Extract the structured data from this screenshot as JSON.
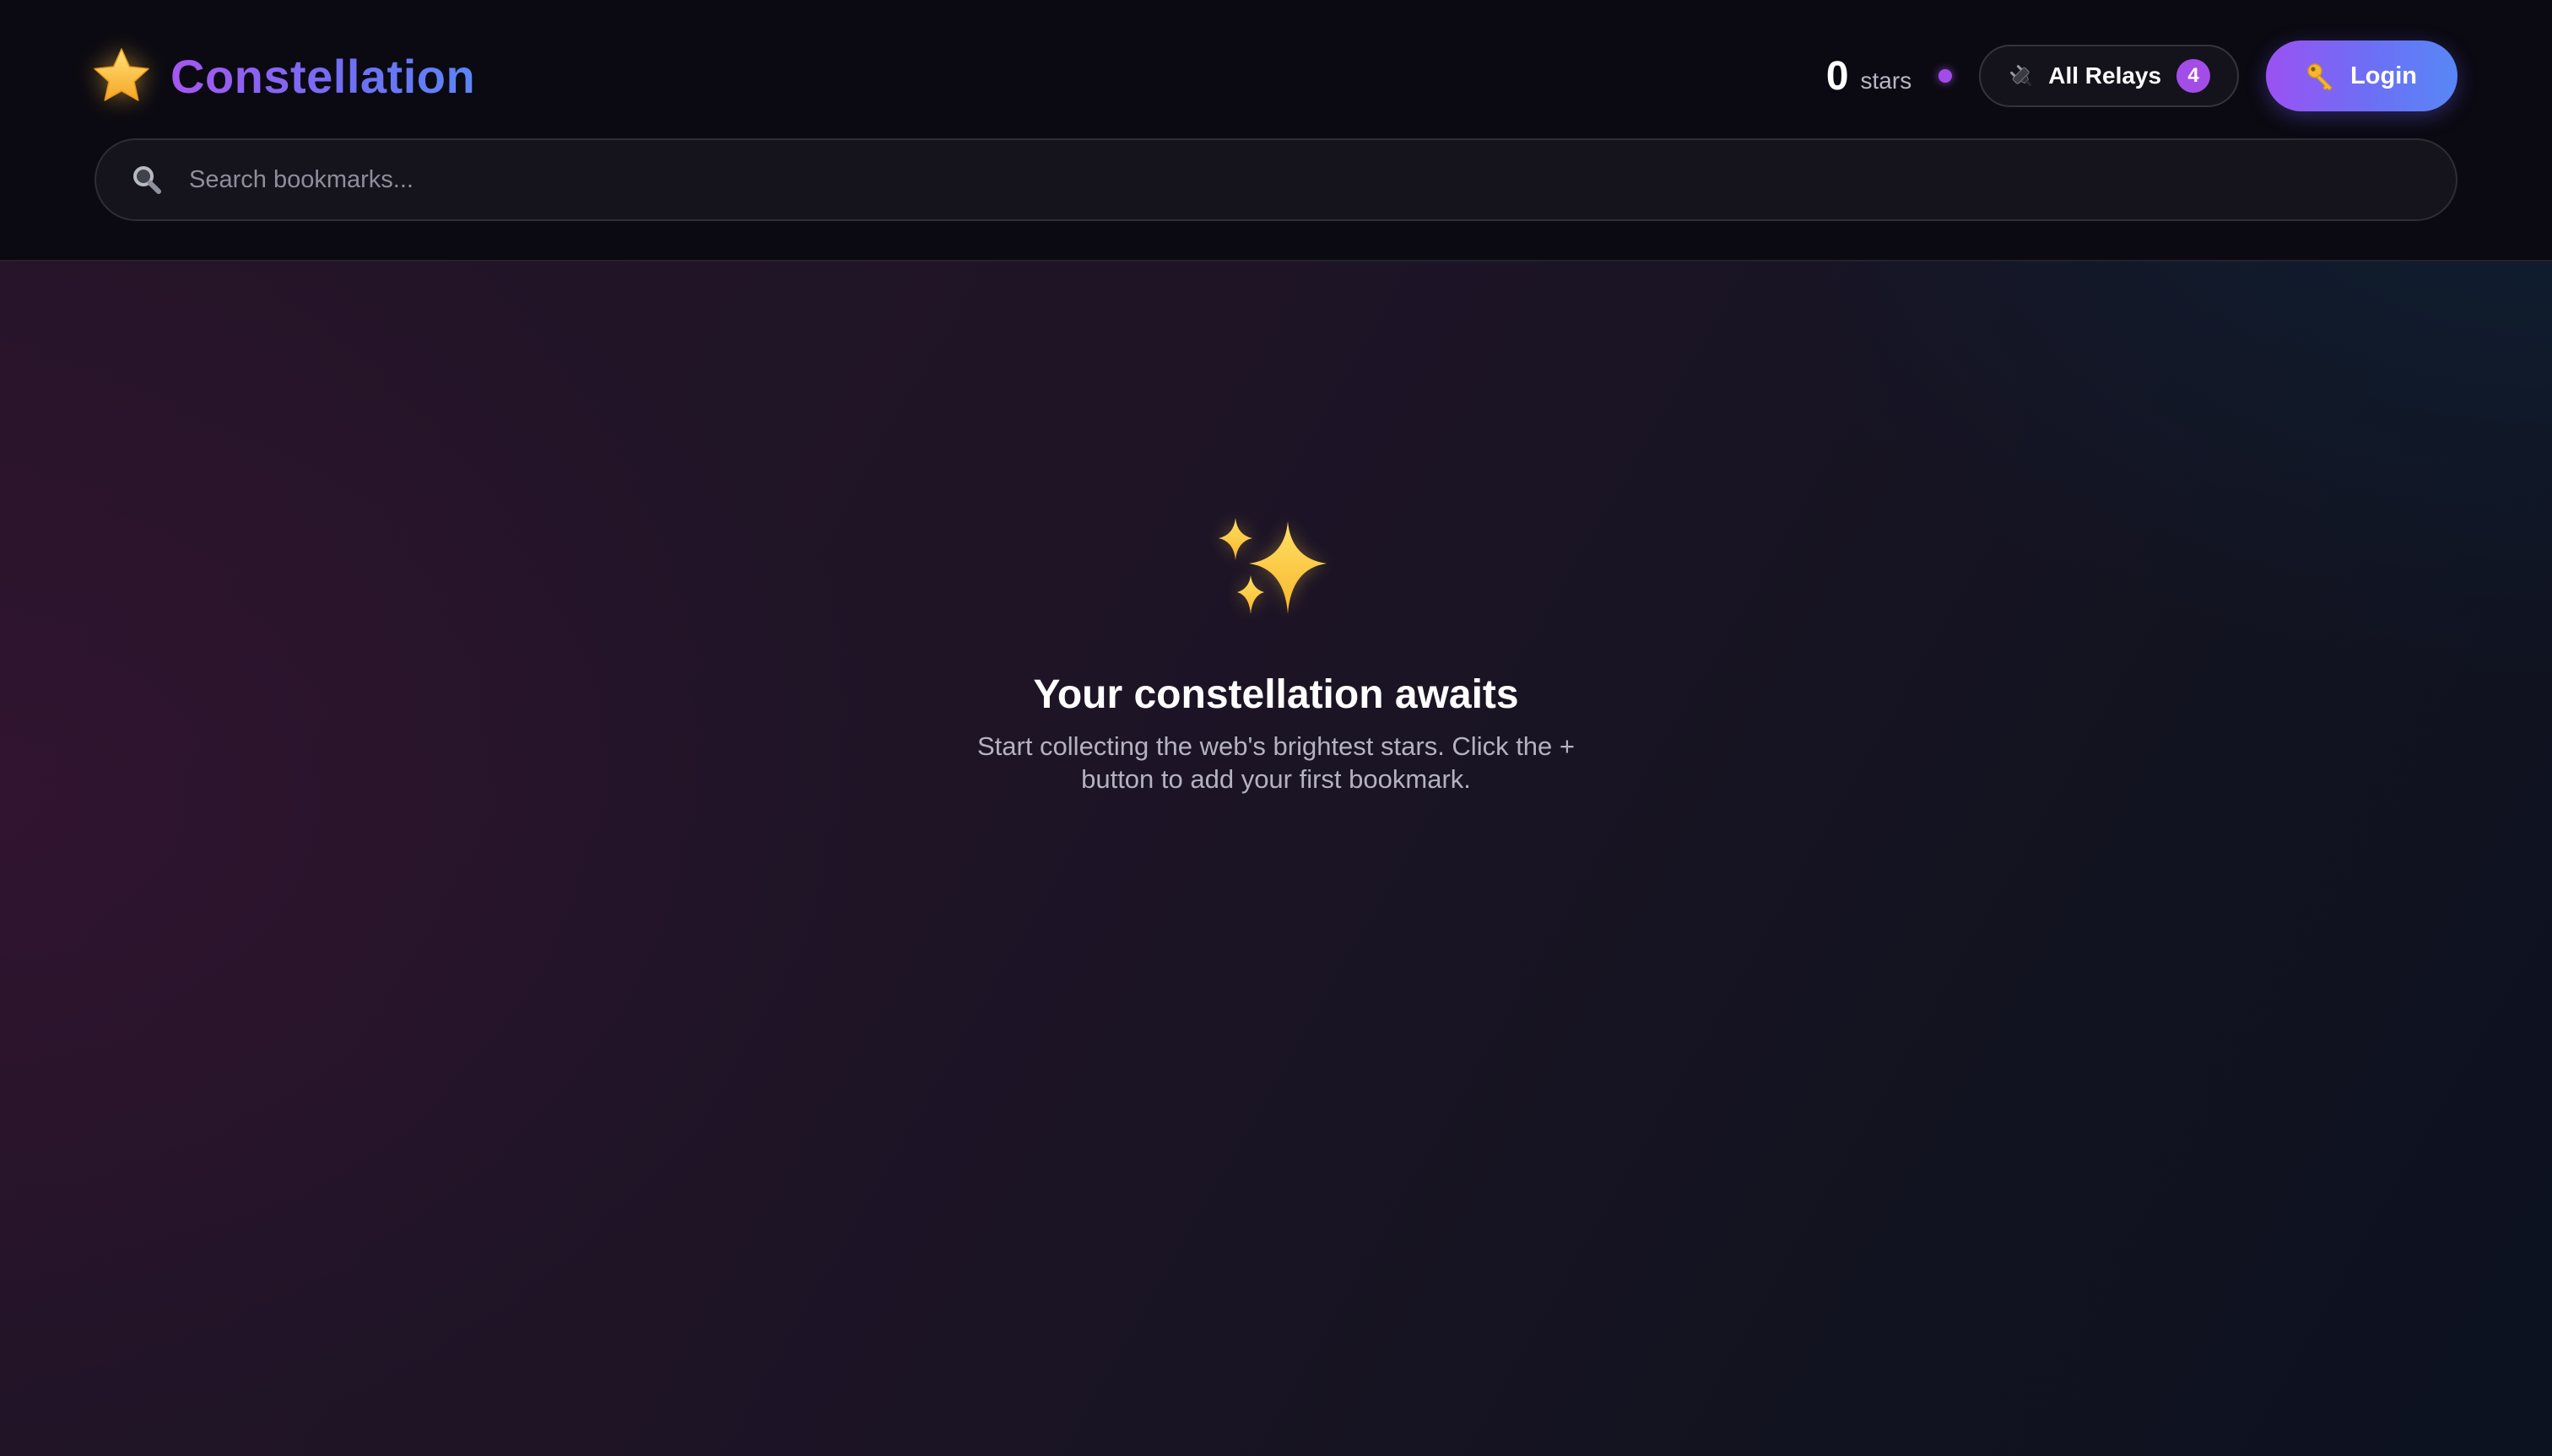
{
  "header": {
    "brand": {
      "icon": "star-icon",
      "title": "Constellation"
    },
    "stars": {
      "count": "0",
      "label": "stars"
    },
    "status_dot_color": "#a24de8",
    "relays": {
      "icon": "plug-icon",
      "label": "All Relays",
      "badge": "4"
    },
    "login": {
      "icon": "key-icon",
      "label": "Login"
    },
    "search": {
      "icon": "search-icon",
      "placeholder": "Search bookmarks...",
      "value": ""
    }
  },
  "empty_state": {
    "icon": "sparkles-icon",
    "title": "Your constellation awaits",
    "description": "Start collecting the web's brightest stars. Click the + button to add your first bookmark."
  },
  "colors": {
    "accent_purple": "#a24de8",
    "accent_blue": "#5887f6",
    "header_bg": "#0b0a12"
  }
}
